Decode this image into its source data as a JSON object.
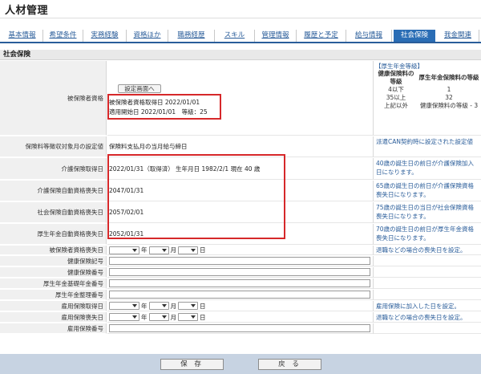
{
  "page_title": "人材管理",
  "tabs": [
    {
      "label": "基本情報",
      "active": false
    },
    {
      "label": "希望条件",
      "active": false
    },
    {
      "label": "実務経験",
      "active": false
    },
    {
      "label": "資格ほか",
      "active": false
    },
    {
      "label": "職務経歴",
      "active": false
    },
    {
      "label": "スキル",
      "active": false
    },
    {
      "label": "管理情報",
      "active": false
    },
    {
      "label": "履歴と予定",
      "active": false
    },
    {
      "label": "給与情報",
      "active": false
    },
    {
      "label": "社会保険",
      "active": true
    },
    {
      "label": "我金関連",
      "active": false
    }
  ],
  "section_title": "社会保険",
  "qualification": {
    "label": "被保険者資格",
    "setting_button": "設定画面へ",
    "line1": "被保険者資格取得日 2022/01/01",
    "line2": "適用開始日 2022/01/01　等級：25"
  },
  "grade_table": {
    "title": "【厚生年金等級】",
    "header_col1": "健康保険料の等級",
    "header_col2": "厚生年金保険料の等級",
    "rows": [
      {
        "c1": "4以下",
        "c2": "1"
      },
      {
        "c1": "35以上",
        "c2": "32"
      },
      {
        "c1": "上記以外",
        "c2": "健康保険料の等級 - 3"
      }
    ]
  },
  "rows": {
    "base_month": {
      "label": "保険料等徴収対象月の設定値",
      "value": "保険料支払月の当月給与締日",
      "note": "派遣CAN契約時に設定された設定値"
    },
    "care_acquired": {
      "label": "介護保険取得日",
      "value": "2022/01/31（取得済） 生年月日 1982/2/1 現在 40 歳",
      "note": "40歳の誕生日の前日が介護保険加入日になります。"
    },
    "care_lost": {
      "label": "介護保険自動資格喪失日",
      "value": "2047/01/31",
      "note": "65歳の誕生日の前日が介護保険資格喪失日になります。"
    },
    "social_lost": {
      "label": "社会保険自動資格喪失日",
      "value": "2057/02/01",
      "note": "75歳の誕生日の当日が社会保険資格喪失日になります。"
    },
    "pension_lost": {
      "label": "厚生年金自動資格喪失日",
      "value": "2052/01/31",
      "note": "70歳の誕生日の前日が厚生年金資格喪失日になります。"
    },
    "insured_lost": {
      "label": "被保険者資格喪失日",
      "note": "退職などの場合の喪失日を設定。"
    },
    "health_symbol": {
      "label": "健康保険記号"
    },
    "health_number": {
      "label": "健康保険番号"
    },
    "pension_base_number": {
      "label": "厚生年金基礎年金番号"
    },
    "pension_ref_number": {
      "label": "厚生年金整理番号"
    },
    "emp_acquired": {
      "label": "雇用保険取得日",
      "note": "雇用保険に加入した日を設定。"
    },
    "emp_lost": {
      "label": "雇用保険喪失日",
      "note": "退職などの場合の喪失日を設定。"
    },
    "emp_number": {
      "label": "雇用保険番号"
    }
  },
  "date_units": {
    "year": "年",
    "month": "月",
    "day": "日"
  },
  "footer": {
    "save": "保 存",
    "back": "戻 る"
  },
  "colors": {
    "accent": "#2a6db5",
    "highlight_box": "#d6282a",
    "link_text": "#2a5d9a",
    "footer_bar": "#c7d3e2"
  }
}
